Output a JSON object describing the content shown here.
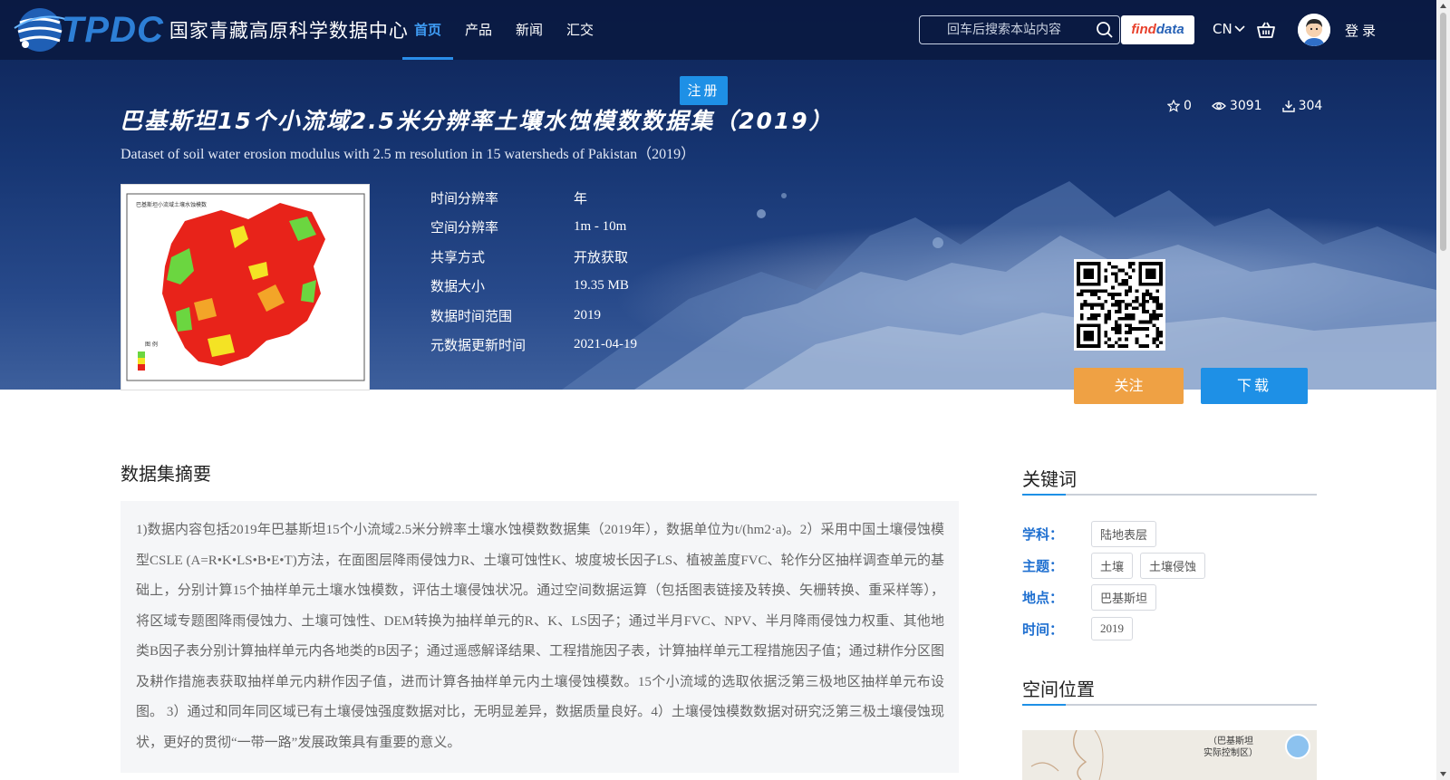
{
  "header": {
    "logo_abbr": "TPDC",
    "logo_name": "国家青藏高原科学数据中心",
    "nav": [
      {
        "label": "首页",
        "active": true
      },
      {
        "label": "产品",
        "active": false
      },
      {
        "label": "新闻",
        "active": false
      },
      {
        "label": "汇交",
        "active": false
      }
    ],
    "search_placeholder": "回车后搜索本站内容",
    "findata_part1": "find",
    "findata_part2": "ata",
    "lang": "CN",
    "login": "登录",
    "register": "注册"
  },
  "dataset": {
    "title_cn": "巴基斯坦15个小流域2.5米分辨率土壤水蚀模数数据集（2019）",
    "title_en": "Dataset of soil water erosion modulus with 2.5 m resolution in 15 watersheds of Pakistan（2019）",
    "stats": {
      "stars": "0",
      "views": "3091",
      "downloads": "304"
    },
    "thumbnail_caption": "巴基斯坦小流域土壤水蚀模数",
    "meta": [
      {
        "key": "时间分辨率",
        "value": "年"
      },
      {
        "key": "空间分辨率",
        "value": "1m - 10m"
      },
      {
        "key": "共享方式",
        "value": "开放获取"
      },
      {
        "key": "数据大小",
        "value": "19.35 MB"
      },
      {
        "key": "数据时间范围",
        "value": "2019"
      },
      {
        "key": "元数据更新时间",
        "value": "2021-04-19"
      }
    ],
    "follow_label": "关注",
    "download_label": "下载"
  },
  "abstract": {
    "heading": "数据集摘要",
    "text": "1)数据内容包括2019年巴基斯坦15个小流域2.5米分辨率土壤水蚀模数数据集（2019年），数据单位为t/(hm2·a)。2）采用中国土壤侵蚀模型CSLE (A=R•K•LS•B•E•T)方法，在面图层降雨侵蚀力R、土壤可蚀性K、坡度坡长因子LS、植被盖度FVC、轮作分区抽样调查单元的基础上，分别计算15个抽样单元土壤水蚀模数，评估土壤侵蚀状况。通过空间数据运算（包括图表链接及转换、矢栅转换、重采样等），将区域专题图降雨侵蚀力、土壤可蚀性、DEM转换为抽样单元的R、K、LS因子；通过半月FVC、NPV、半月降雨侵蚀力权重、其他地类B因子表分别计算抽样单元内各地类的B因子；通过遥感解译结果、工程措施因子表，计算抽样单元工程措施因子值；通过耕作分区图及耕作措施表获取抽样单元内耕作因子值，进而计算各抽样单元内土壤侵蚀模数。15个小流域的选取依据泛第三极地区抽样单元布设图。 3）通过和同年同区域已有土壤侵蚀强度数据对比，无明显差异，数据质量良好。4）土壤侵蚀模数数据对研究泛第三极土壤侵蚀现状，更好的贯彻“一带一路”发展政策具有重要的意义。"
  },
  "keywords": {
    "heading": "关键词",
    "rows": [
      {
        "label": "学科：",
        "tags": [
          "陆地表层"
        ]
      },
      {
        "label": "主题：",
        "tags": [
          "土壤",
          "土壤侵蚀"
        ]
      },
      {
        "label": "地点：",
        "tags": [
          "巴基斯坦"
        ]
      },
      {
        "label": "时间：",
        "tags": [
          "2019"
        ]
      }
    ]
  },
  "location": {
    "heading": "空间位置",
    "map_label_line1": "（巴基斯坦",
    "map_label_line2": "实际控制区）"
  }
}
